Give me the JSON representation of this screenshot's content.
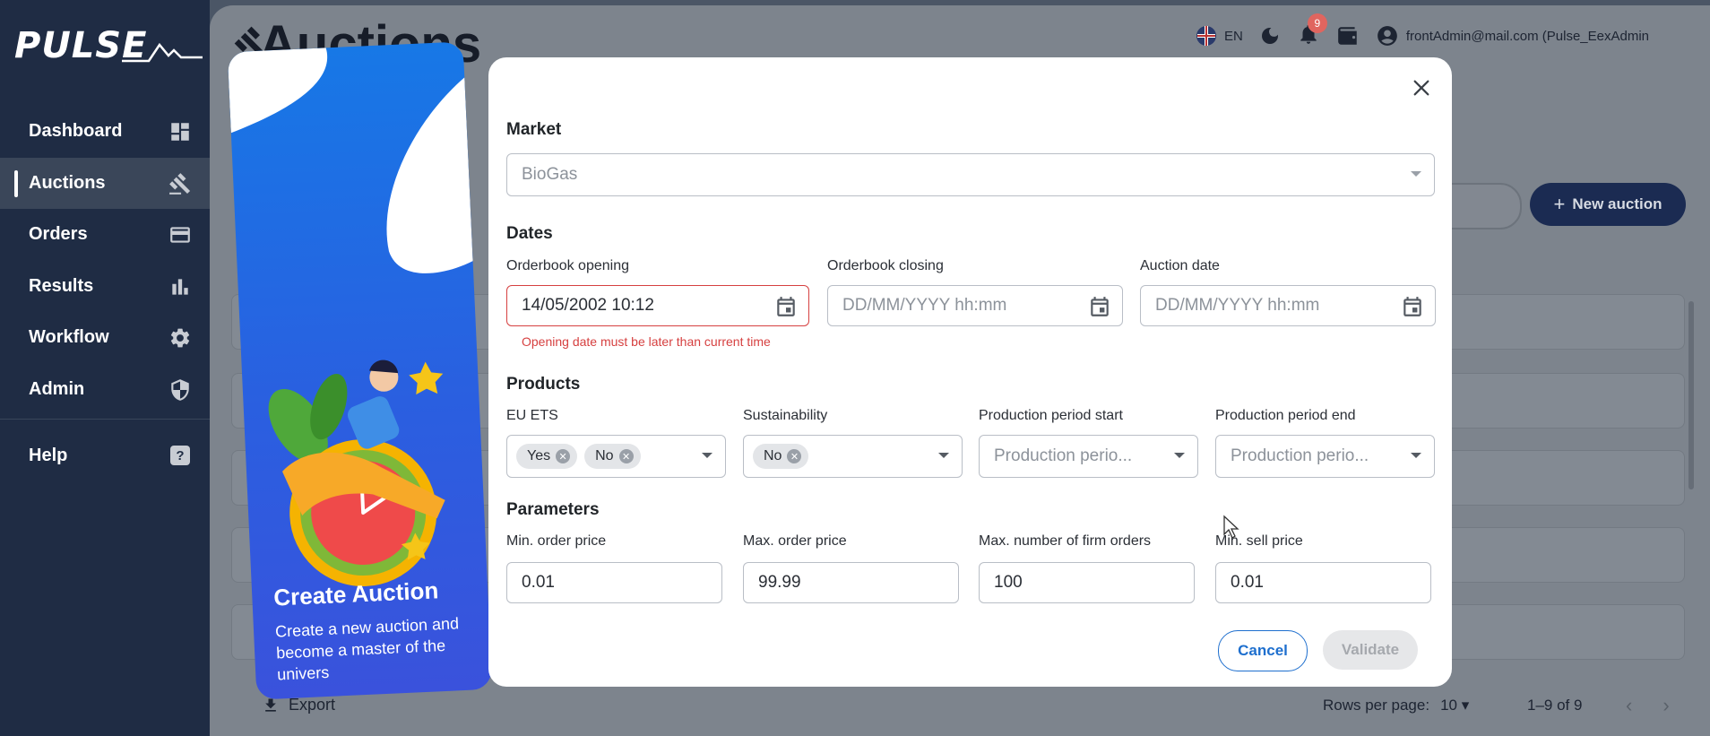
{
  "sidebar": {
    "logo": "PULSE",
    "items": [
      {
        "label": "Dashboard",
        "icon": "dashboard-icon"
      },
      {
        "label": "Auctions",
        "icon": "gavel-icon",
        "active": true
      },
      {
        "label": "Orders",
        "icon": "credit-card-icon"
      },
      {
        "label": "Results",
        "icon": "bar-chart-icon"
      },
      {
        "label": "Workflow",
        "icon": "gear-icon"
      },
      {
        "label": "Admin",
        "icon": "shield-icon"
      }
    ],
    "help": {
      "label": "Help",
      "icon": "help-icon"
    }
  },
  "header": {
    "page_title": "Auctions",
    "language": "EN",
    "notifications_count": "9",
    "user": "frontAdmin@mail.com (Pulse_EexAdmin",
    "new_auction_label": "New auction"
  },
  "footer": {
    "export_label": "Export",
    "rows_per_page_label": "Rows per page:",
    "rows_per_page_value": "10",
    "range": "1–9 of 9"
  },
  "promo": {
    "title": "Create Auction",
    "text": "Create a new auction and become a master of the univers"
  },
  "modal": {
    "market": {
      "section": "Market",
      "value": "BioGas"
    },
    "dates": {
      "section": "Dates",
      "opening_label": "Orderbook opening",
      "opening_value": "14/05/2002 10:12",
      "opening_error": "Opening date must be later than current time",
      "closing_label": "Orderbook closing",
      "closing_placeholder": "DD/MM/YYYY hh:mm",
      "auction_label": "Auction date",
      "auction_placeholder": "DD/MM/YYYY hh:mm"
    },
    "products": {
      "section": "Products",
      "eu_ets_label": "EU ETS",
      "eu_ets_chips": [
        "Yes",
        "No"
      ],
      "sustainability_label": "Sustainability",
      "sustainability_chips": [
        "No"
      ],
      "prod_start_label": "Production period start",
      "prod_start_placeholder": "Production perio...",
      "prod_end_label": "Production period end",
      "prod_end_placeholder": "Production perio..."
    },
    "parameters": {
      "section": "Parameters",
      "min_order_label": "Min. order price",
      "min_order_value": "0.01",
      "max_order_label": "Max. order price",
      "max_order_value": "99.99",
      "max_firm_label": "Max. number of firm orders",
      "max_firm_value": "100",
      "min_sell_label": "Min. sell price",
      "min_sell_value": "0.01"
    },
    "cancel_label": "Cancel",
    "validate_label": "Validate"
  },
  "colors": {
    "sidebar_bg": "#1f2c44",
    "accent_blue": "#1e6fce",
    "error_red": "#d64040",
    "promo_blue": "#1778e6"
  }
}
